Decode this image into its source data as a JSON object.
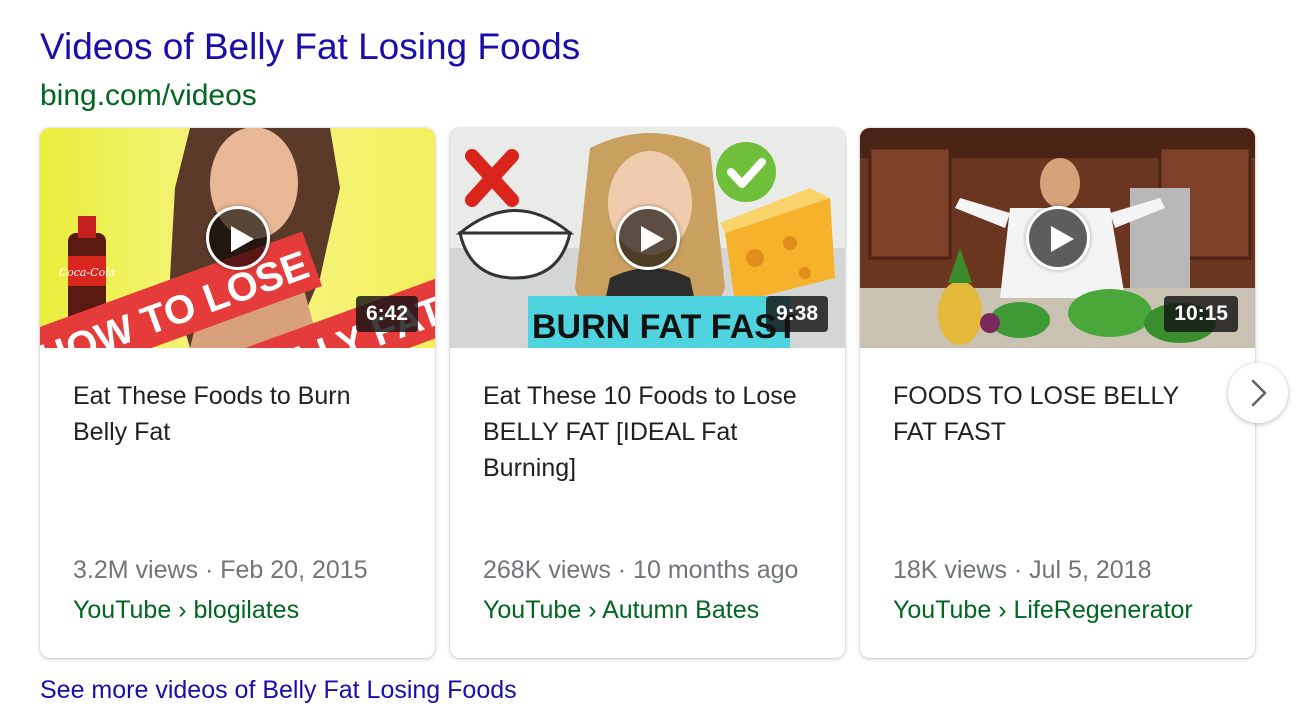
{
  "header": {
    "title": "Videos of Belly Fat Losing Foods",
    "url": "bing.com/videos"
  },
  "videos": [
    {
      "title": "Eat These Foods to Burn Belly Fat",
      "duration": "6:42",
      "meta": "3.2M views · Feb 20, 2015",
      "source": "YouTube › blogilates",
      "thumb_text_1": "HOW TO LOSE",
      "thumb_text_2": "BELLY FAT",
      "bottle_label": "Coca-Cola"
    },
    {
      "title": "Eat These 10 Foods to Lose BELLY FAT [IDEAL Fat Burning]",
      "duration": "9:38",
      "meta": "268K views · 10 months ago",
      "source": "YouTube › Autumn Bates",
      "thumb_text_1": "BURN FAT FAST"
    },
    {
      "title": "FOODS TO LOSE BELLY FAT FAST",
      "duration": "10:15",
      "meta": "18K views · Jul 5, 2018",
      "source": "YouTube › LifeRegenerator"
    }
  ],
  "see_more": "See more videos of Belly Fat Losing Foods",
  "icons": {
    "play": "play-icon",
    "next": "chevron-right-icon",
    "x_mark": "x-mark-icon",
    "check_mark": "check-mark-icon"
  },
  "colors": {
    "link": "#1a0dab",
    "url_green": "#006621",
    "meta_gray": "#70757a",
    "title_text": "#202124"
  }
}
